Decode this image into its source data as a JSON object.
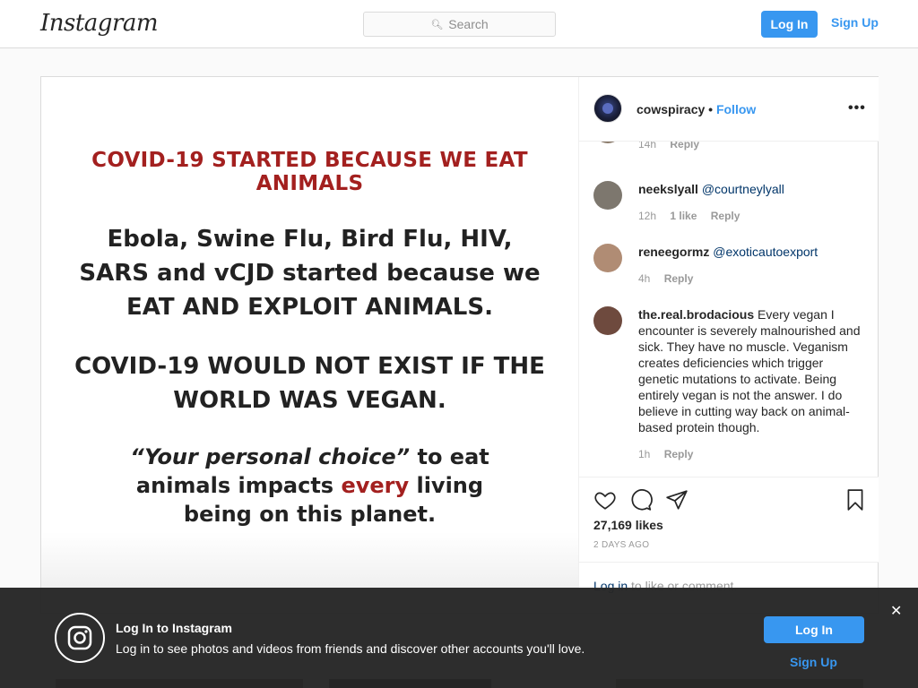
{
  "header": {
    "logo": "Instagram",
    "search_placeholder": "Search",
    "login_label": "Log In",
    "signup_label": "Sign Up"
  },
  "post": {
    "owner": "cowspiracy",
    "separator": "•",
    "follow_label": "Follow",
    "more_label": "•••",
    "image_text": {
      "headline": "COVID-19 STARTED BECAUSE WE EAT ANIMALS",
      "para1": [
        "Ebola, Swine Flu, Bird Flu, HIV,",
        "SARS and vCJD started because we",
        "EAT AND EXPLOIT ANIMALS."
      ],
      "para2": [
        "COVID-19 WOULD NOT EXIST IF THE",
        "WORLD WAS VEGAN."
      ],
      "para3_quote": "“Your personal choice”",
      "para3_rest1": " to eat",
      "para3_line2a": "animals impacts ",
      "para3_red": "every",
      "para3_line2b": " living",
      "para3_line3": "being on this planet."
    },
    "comments": [
      {
        "time": "14h",
        "reply": "Reply"
      },
      {
        "user": "neekslyall",
        "text": "@courtneylyall",
        "time": "12h",
        "likes": "1 like",
        "reply": "Reply"
      },
      {
        "user": "reneegormz",
        "text": "@exoticautoexport",
        "time": "4h",
        "reply": "Reply"
      },
      {
        "user": "the.real.brodacious",
        "text": "Every vegan I encounter is severely malnourished and sick. They have no muscle. Veganism creates deficiencies which trigger genetic mutations to activate. Being entirely vegan is not the answer. I do believe in cutting way back on animal-based protein though.",
        "time": "1h",
        "reply": "Reply"
      }
    ],
    "likes": "27,169 likes",
    "time_ago": "2 DAYS AGO",
    "login_link": "Log in",
    "login_rest": " to like or comment."
  },
  "banner": {
    "title": "Log In to Instagram",
    "text": "Log in to see photos and videos from friends and discover other accounts you'll love.",
    "login_label": "Log In",
    "signup_label": "Sign Up",
    "close": "✕"
  },
  "colors": {
    "accent": "#3897f0",
    "headline_red": "#a3201f",
    "banner_bg": "#262626"
  }
}
